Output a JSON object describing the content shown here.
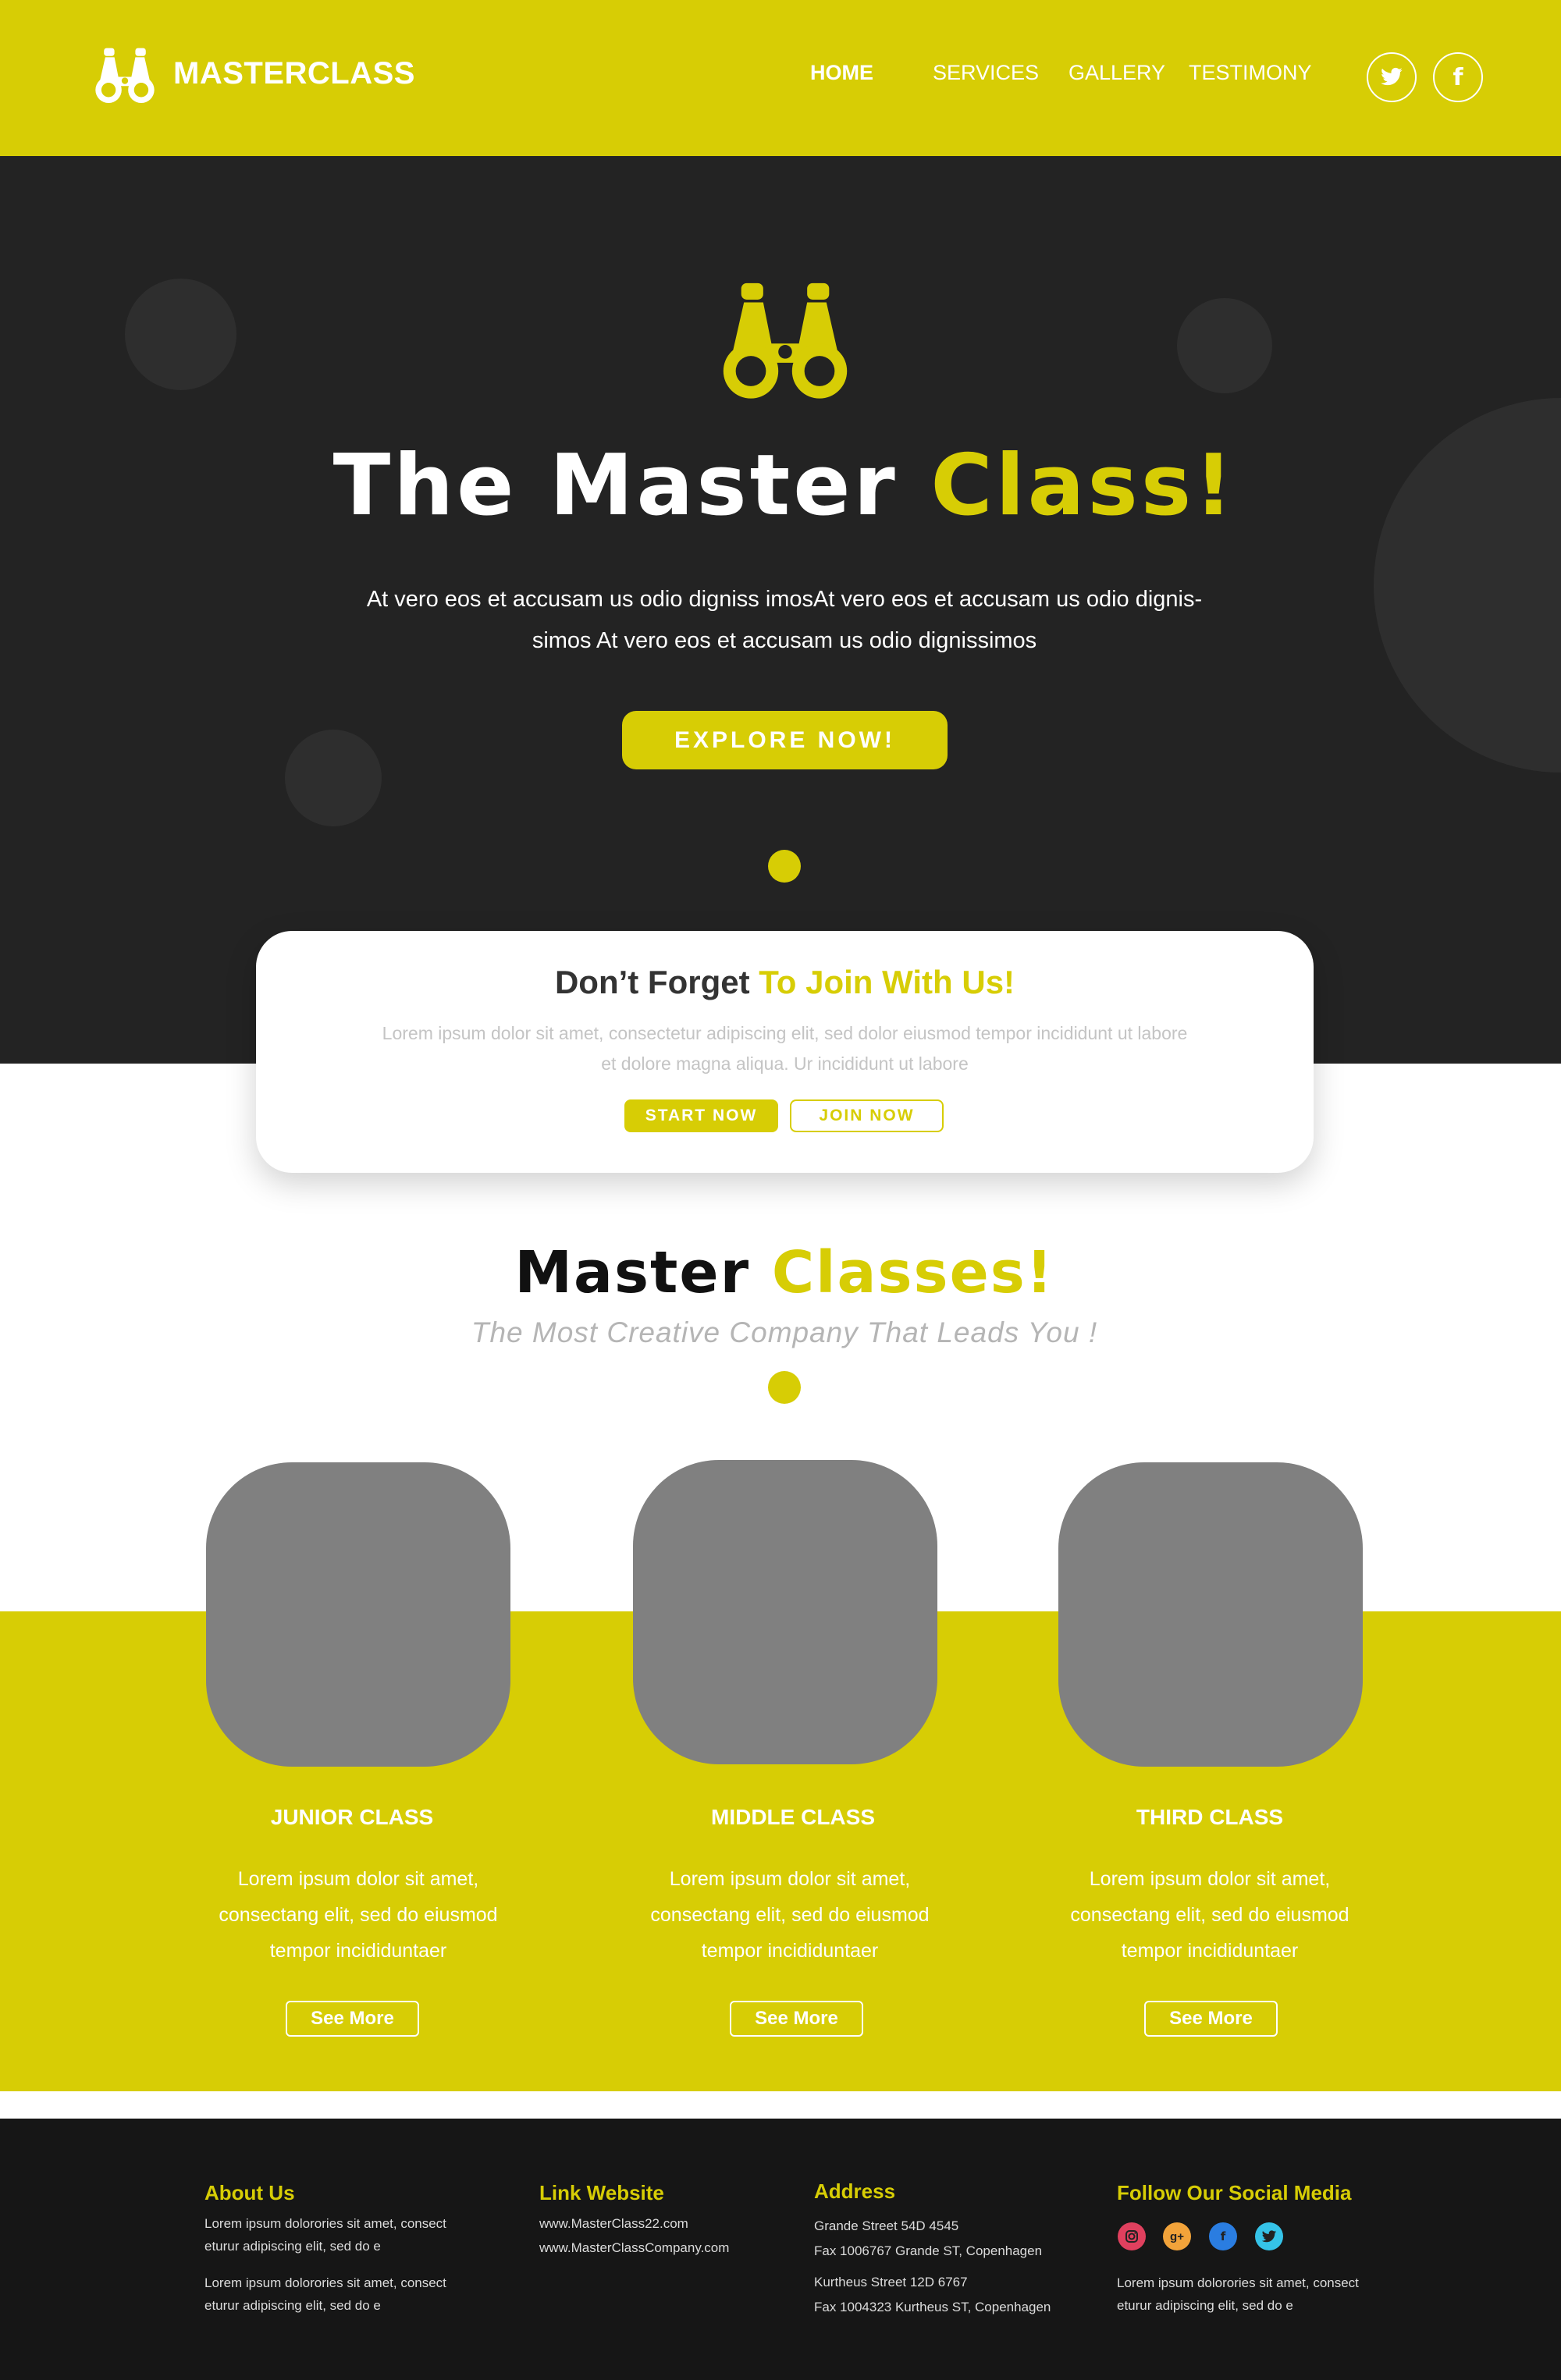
{
  "header": {
    "brand": "MASTERCLASS",
    "nav": [
      "HOME",
      "SERVICES",
      "GALLERY",
      "TESTIMONY"
    ],
    "social": [
      "twitter-icon",
      "facebook-icon"
    ]
  },
  "hero": {
    "title_main": "The Master ",
    "title_highlight": "Class!",
    "desc_line1": "At vero eos et accusam us odio digniss imosAt vero eos et accusam us odio dignis-",
    "desc_line2": "simos At vero eos et accusam us odio dignissimos",
    "cta": "EXPLORE  NOW!"
  },
  "join": {
    "title_main": "Don’t Forget ",
    "title_highlight": "To Join With Us!",
    "desc_line1": "Lorem ipsum dolor sit amet, consectetur adipiscing elit, sed dolor eiusmod tempor incididunt ut labore",
    "desc_line2": "et dolore magna aliqua. Ur incididunt ut labore",
    "start_label": "START NOW",
    "join_label": "JOIN NOW"
  },
  "classes": {
    "title_main": "Master ",
    "title_highlight": "Classes!",
    "subtitle": "The Most Creative Company That Leads You !",
    "items": [
      {
        "title": "JUNIOR CLASS",
        "line1": "Lorem ipsum dolor sit amet,",
        "line2": "consectang elit, sed do eiusmod",
        "line3": "tempor incididuntaer",
        "button": "See More"
      },
      {
        "title": "MIDDLE CLASS",
        "line1": "Lorem ipsum dolor sit amet,",
        "line2": "consectang elit, sed do eiusmod",
        "line3": "tempor incididuntaer",
        "button": "See More"
      },
      {
        "title": "THIRD CLASS",
        "line1": "Lorem ipsum dolor sit amet,",
        "line2": "consectang elit, sed do eiusmod",
        "line3": "tempor incididuntaer",
        "button": "See More"
      }
    ]
  },
  "footer": {
    "about": {
      "heading": "About Us",
      "p1_line1": "Lorem ipsum dolorories sit amet, consect",
      "p1_line2": "eturur adipiscing elit, sed do e",
      "p2_line1": "Lorem ipsum dolorories sit amet, consect",
      "p2_line2": "eturur adipiscing elit, sed do e"
    },
    "links": {
      "heading": "Link Website",
      "link1": "www.MasterClass22.com",
      "link2": "www.MasterClassCompany.com"
    },
    "address": {
      "heading": "Address",
      "line1": "Grande Street 54D 4545",
      "line2": "Fax 1006767 Grande ST, Copenhagen",
      "line3": "Kurtheus Street 12D 6767",
      "line4": "Fax 1004323 Kurtheus ST, Copenhagen"
    },
    "social": {
      "heading": "Follow Our Social Media",
      "icons": [
        "instagram-icon",
        "google-plus-icon",
        "facebook-icon",
        "twitter-icon"
      ],
      "icon_colors": [
        "#e0405e",
        "#f2a33a",
        "#2a7de1",
        "#35c3e8"
      ],
      "line1": "Lorem ipsum dolorories sit amet, consect",
      "line2": "eturur adipiscing elit, sed do e"
    }
  },
  "colors": {
    "accent": "#d7cd05",
    "dark": "#232323",
    "footer": "#161616",
    "placeholder": "#808080"
  }
}
